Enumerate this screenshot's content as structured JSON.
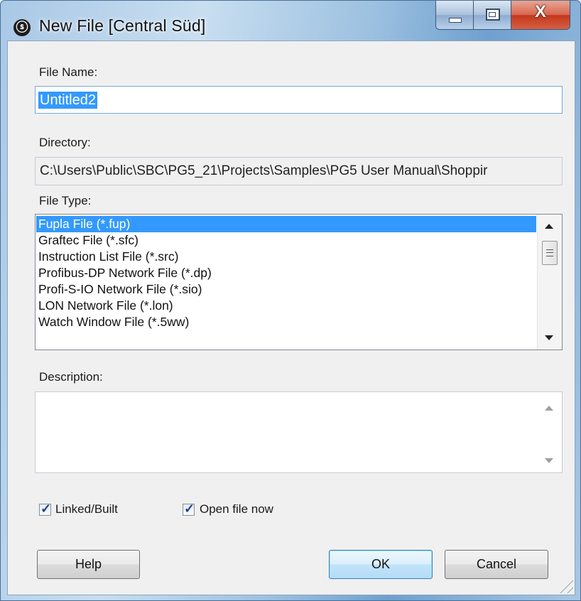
{
  "window": {
    "title": "New File [Central Süd]",
    "icon": "saia-logo-icon",
    "close_glyph": "X"
  },
  "form": {
    "filename_label": "File Name:",
    "filename_value": "Untitled2",
    "directory_label": "Directory:",
    "directory_value": "C:\\Users\\Public\\SBC\\PG5_21\\Projects\\Samples\\PG5 User Manual\\Shoppir",
    "filetype_label": "File Type:",
    "file_types": [
      "Fupla File (*.fup)",
      "Graftec File (*.sfc)",
      "Instruction List File (*.src)",
      "Profibus-DP Network File (*.dp)",
      "Profi-S-IO Network File (*.sio)",
      "LON Network File (*.lon)",
      "Watch Window File (*.5ww)"
    ],
    "selected_file_type": "Fupla File (*.fup)",
    "description_label": "Description:",
    "description_value": ""
  },
  "options": {
    "linked_label": "Linked/Built",
    "linked_checked": true,
    "open_label": "Open file now",
    "open_checked": true
  },
  "buttons": {
    "help": "Help",
    "ok": "OK",
    "cancel": "Cancel"
  },
  "colors": {
    "selection": "#3399ff",
    "client_bg": "#f0f0f0",
    "close_button": "#c4371c"
  }
}
